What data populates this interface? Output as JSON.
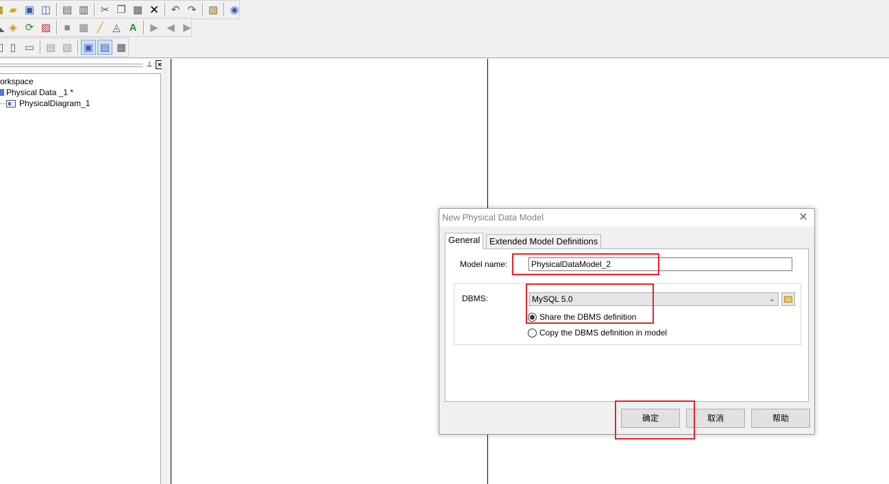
{
  "toolbar": {
    "row1": [
      "new-icon",
      "open-icon",
      "save-icon",
      "save-all-icon",
      "print-preview-icon",
      "print-icon",
      "cut-icon",
      "copy-icon",
      "paste-icon",
      "delete-icon",
      "undo-icon",
      "redo-icon",
      "properties-icon",
      "help-icon"
    ],
    "row2": [
      "find-icon",
      "check-model-icon",
      "refresh-icon",
      "impact-analysis-icon",
      "bring-front-icon",
      "send-back-icon",
      "line-style-icon",
      "fill-icon",
      "font-icon",
      "format-painter-icon",
      "arrow-left-icon",
      "arrow-right-icon"
    ],
    "row3": [
      "page-icon",
      "page-view-icon",
      "page-view2-icon",
      "zoom-in-icon",
      "zoom-out-icon",
      "browser-view-icon",
      "output-view-icon",
      "result-list-icon"
    ]
  },
  "browser": {
    "header_pin": "⊥",
    "header_close": "×",
    "tree": [
      {
        "label": "orkspace"
      },
      {
        "label": "Physical Data _1 *"
      },
      {
        "label": "PhysicalDiagram_1"
      }
    ]
  },
  "dialog": {
    "title": "New Physical Data Model",
    "close": "✕",
    "tabs": [
      "General",
      "Extended Model Definitions"
    ],
    "model_name_label": "Model name:",
    "model_name_value": "PhysicalDataModel_2",
    "dbms_label": "DBMS:",
    "dbms_value": "MySQL 5.0",
    "options": [
      {
        "label": "Share the DBMS definition",
        "checked": true
      },
      {
        "label": "Copy the DBMS definition in model",
        "checked": false
      }
    ],
    "buttons": {
      "ok": "确定",
      "cancel": "取消",
      "help": "帮助"
    }
  },
  "annotation_color": "#e8202a"
}
